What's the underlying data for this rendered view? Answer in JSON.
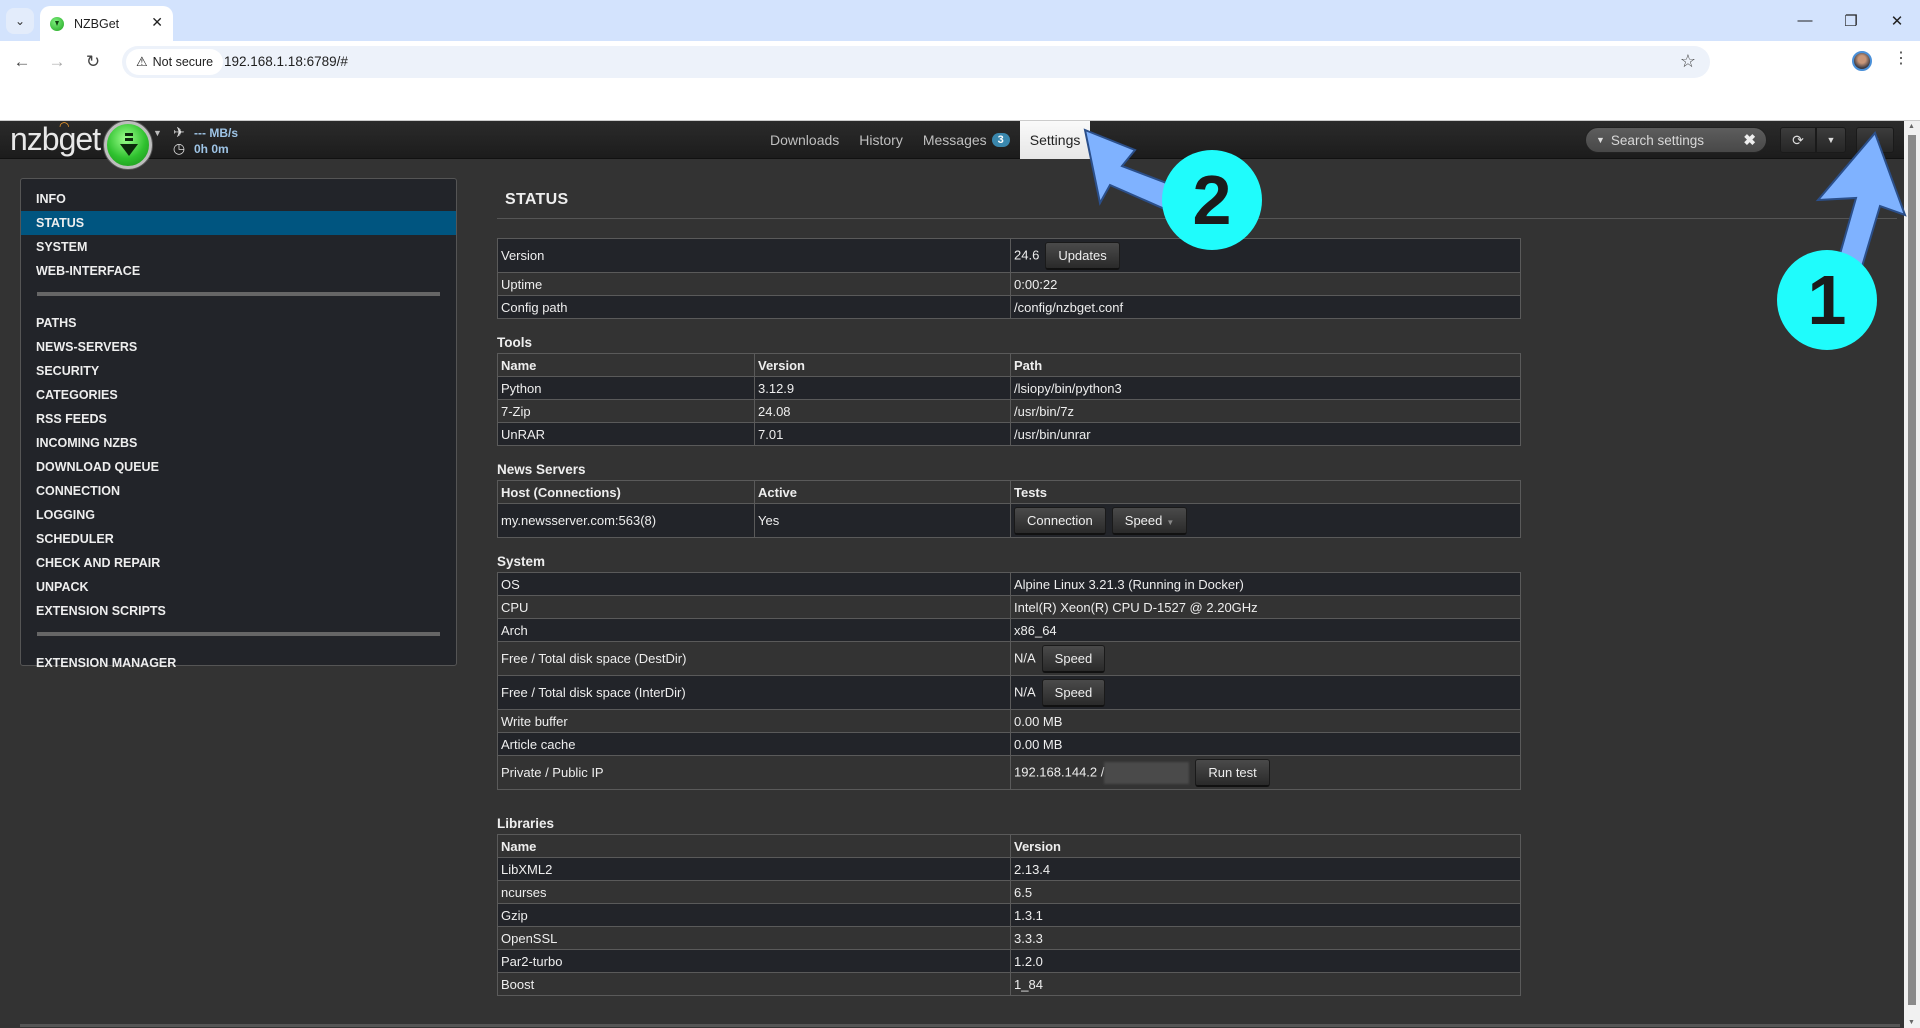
{
  "browser": {
    "tab_title": "NZBGet",
    "security_label": "Not secure",
    "url": "192.168.1.18:6789/#"
  },
  "header": {
    "logo": "nzbget",
    "speed": "--- MB/s",
    "time_left": "0h 0m",
    "nav": [
      {
        "label": "Downloads"
      },
      {
        "label": "History"
      },
      {
        "label": "Messages",
        "badge": "3"
      },
      {
        "label": "Settings",
        "active": true
      }
    ],
    "search_placeholder": "Search settings"
  },
  "sidebar": {
    "group1": [
      "INFO",
      "STATUS",
      "SYSTEM",
      "WEB-INTERFACE"
    ],
    "group2": [
      "PATHS",
      "NEWS-SERVERS",
      "SECURITY",
      "CATEGORIES",
      "RSS FEEDS",
      "INCOMING NZBS",
      "DOWNLOAD QUEUE",
      "CONNECTION",
      "LOGGING",
      "SCHEDULER",
      "CHECK AND REPAIR",
      "UNPACK",
      "EXTENSION SCRIPTS"
    ],
    "group3": [
      "EXTENSION MANAGER"
    ],
    "active": "STATUS"
  },
  "page": {
    "title": "STATUS",
    "status": {
      "version_label": "Version",
      "version_value": "24.6",
      "updates_button": "Updates",
      "uptime_label": "Uptime",
      "uptime_value": "0:00:22",
      "config_label": "Config path",
      "config_value": "/config/nzbget.conf"
    },
    "tools": {
      "title": "Tools",
      "headers": [
        "Name",
        "Version",
        "Path"
      ],
      "rows": [
        [
          "Python",
          "3.12.9",
          "/lsiopy/bin/python3"
        ],
        [
          "7-Zip",
          "24.08",
          "/usr/bin/7z"
        ],
        [
          "UnRAR",
          "7.01",
          "/usr/bin/unrar"
        ]
      ]
    },
    "news_servers": {
      "title": "News Servers",
      "headers": [
        "Host (Connections)",
        "Active",
        "Tests"
      ],
      "rows": [
        {
          "host": "my.newsserver.com:563(8)",
          "active": "Yes",
          "connection_button": "Connection",
          "speed_button": "Speed"
        }
      ]
    },
    "system": {
      "title": "System",
      "os_label": "OS",
      "os_value": "Alpine Linux 3.21.3 (Running in Docker)",
      "cpu_label": "CPU",
      "cpu_value": "Intel(R) Xeon(R) CPU D-1527 @ 2.20GHz",
      "arch_label": "Arch",
      "arch_value": "x86_64",
      "destdir_label": "Free / Total disk space (DestDir)",
      "destdir_value": "N/A",
      "interdir_label": "Free / Total disk space (InterDir)",
      "interdir_value": "N/A",
      "speed_button": "Speed",
      "write_buffer_label": "Write buffer",
      "write_buffer_value": "0.00 MB",
      "article_cache_label": "Article cache",
      "article_cache_value": "0.00 MB",
      "ip_label": "Private / Public IP",
      "ip_value": "192.168.144.2 /",
      "run_test_button": "Run test"
    },
    "libraries": {
      "title": "Libraries",
      "headers": [
        "Name",
        "Version"
      ],
      "rows": [
        [
          "LibXML2",
          "2.13.4"
        ],
        [
          "ncurses",
          "6.5"
        ],
        [
          "Gzip",
          "1.3.1"
        ],
        [
          "OpenSSL",
          "3.3.3"
        ],
        [
          "Par2-turbo",
          "1.2.0"
        ],
        [
          "Boost",
          "1_84"
        ]
      ]
    }
  },
  "annotations": {
    "callout_1": "1",
    "callout_2": "2",
    "arrow_color": "#7fb2ff",
    "circle_color": "#1ffcfc"
  }
}
